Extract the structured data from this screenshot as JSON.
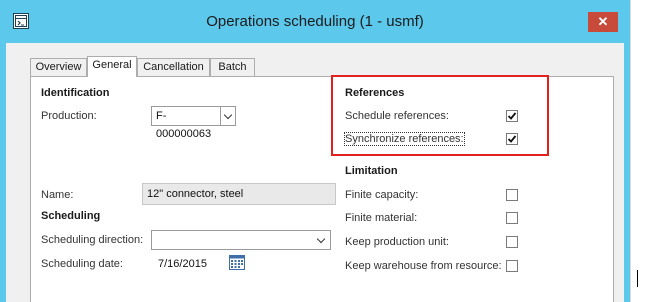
{
  "window": {
    "title": "Operations scheduling (1 - usmf)",
    "close_glyph": "✕",
    "app_icon": "form-window-icon"
  },
  "tabs": [
    {
      "label": "Overview",
      "active": false
    },
    {
      "label": "General",
      "active": true
    },
    {
      "label": "Cancellation",
      "active": false
    },
    {
      "label": "Batch",
      "active": false
    }
  ],
  "identification": {
    "heading": "Identification",
    "production_label": "Production:",
    "production_value": "F-000000063",
    "name_label": "Name:",
    "name_value": "12\" connector, steel"
  },
  "scheduling": {
    "heading": "Scheduling",
    "direction_label": "Scheduling direction:",
    "direction_value": "",
    "date_label": "Scheduling date:",
    "date_value": "7/16/2015",
    "calendar_icon": "calendar-icon"
  },
  "references": {
    "heading": "References",
    "schedule_label": "Schedule references:",
    "schedule_checked": true,
    "synchronize_label": "Synchronize references:",
    "synchronize_checked": true
  },
  "limitation": {
    "heading": "Limitation",
    "finite_capacity_label": "Finite capacity:",
    "finite_capacity_checked": false,
    "finite_material_label": "Finite material:",
    "finite_material_checked": false,
    "keep_production_unit_label": "Keep production unit:",
    "keep_production_unit_checked": false,
    "keep_warehouse_label": "Keep warehouse from resource:",
    "keep_warehouse_checked": false
  },
  "colors": {
    "titlebar": "#5bc8ec",
    "close_button": "#c74a3b",
    "highlight_box": "#e32020"
  }
}
